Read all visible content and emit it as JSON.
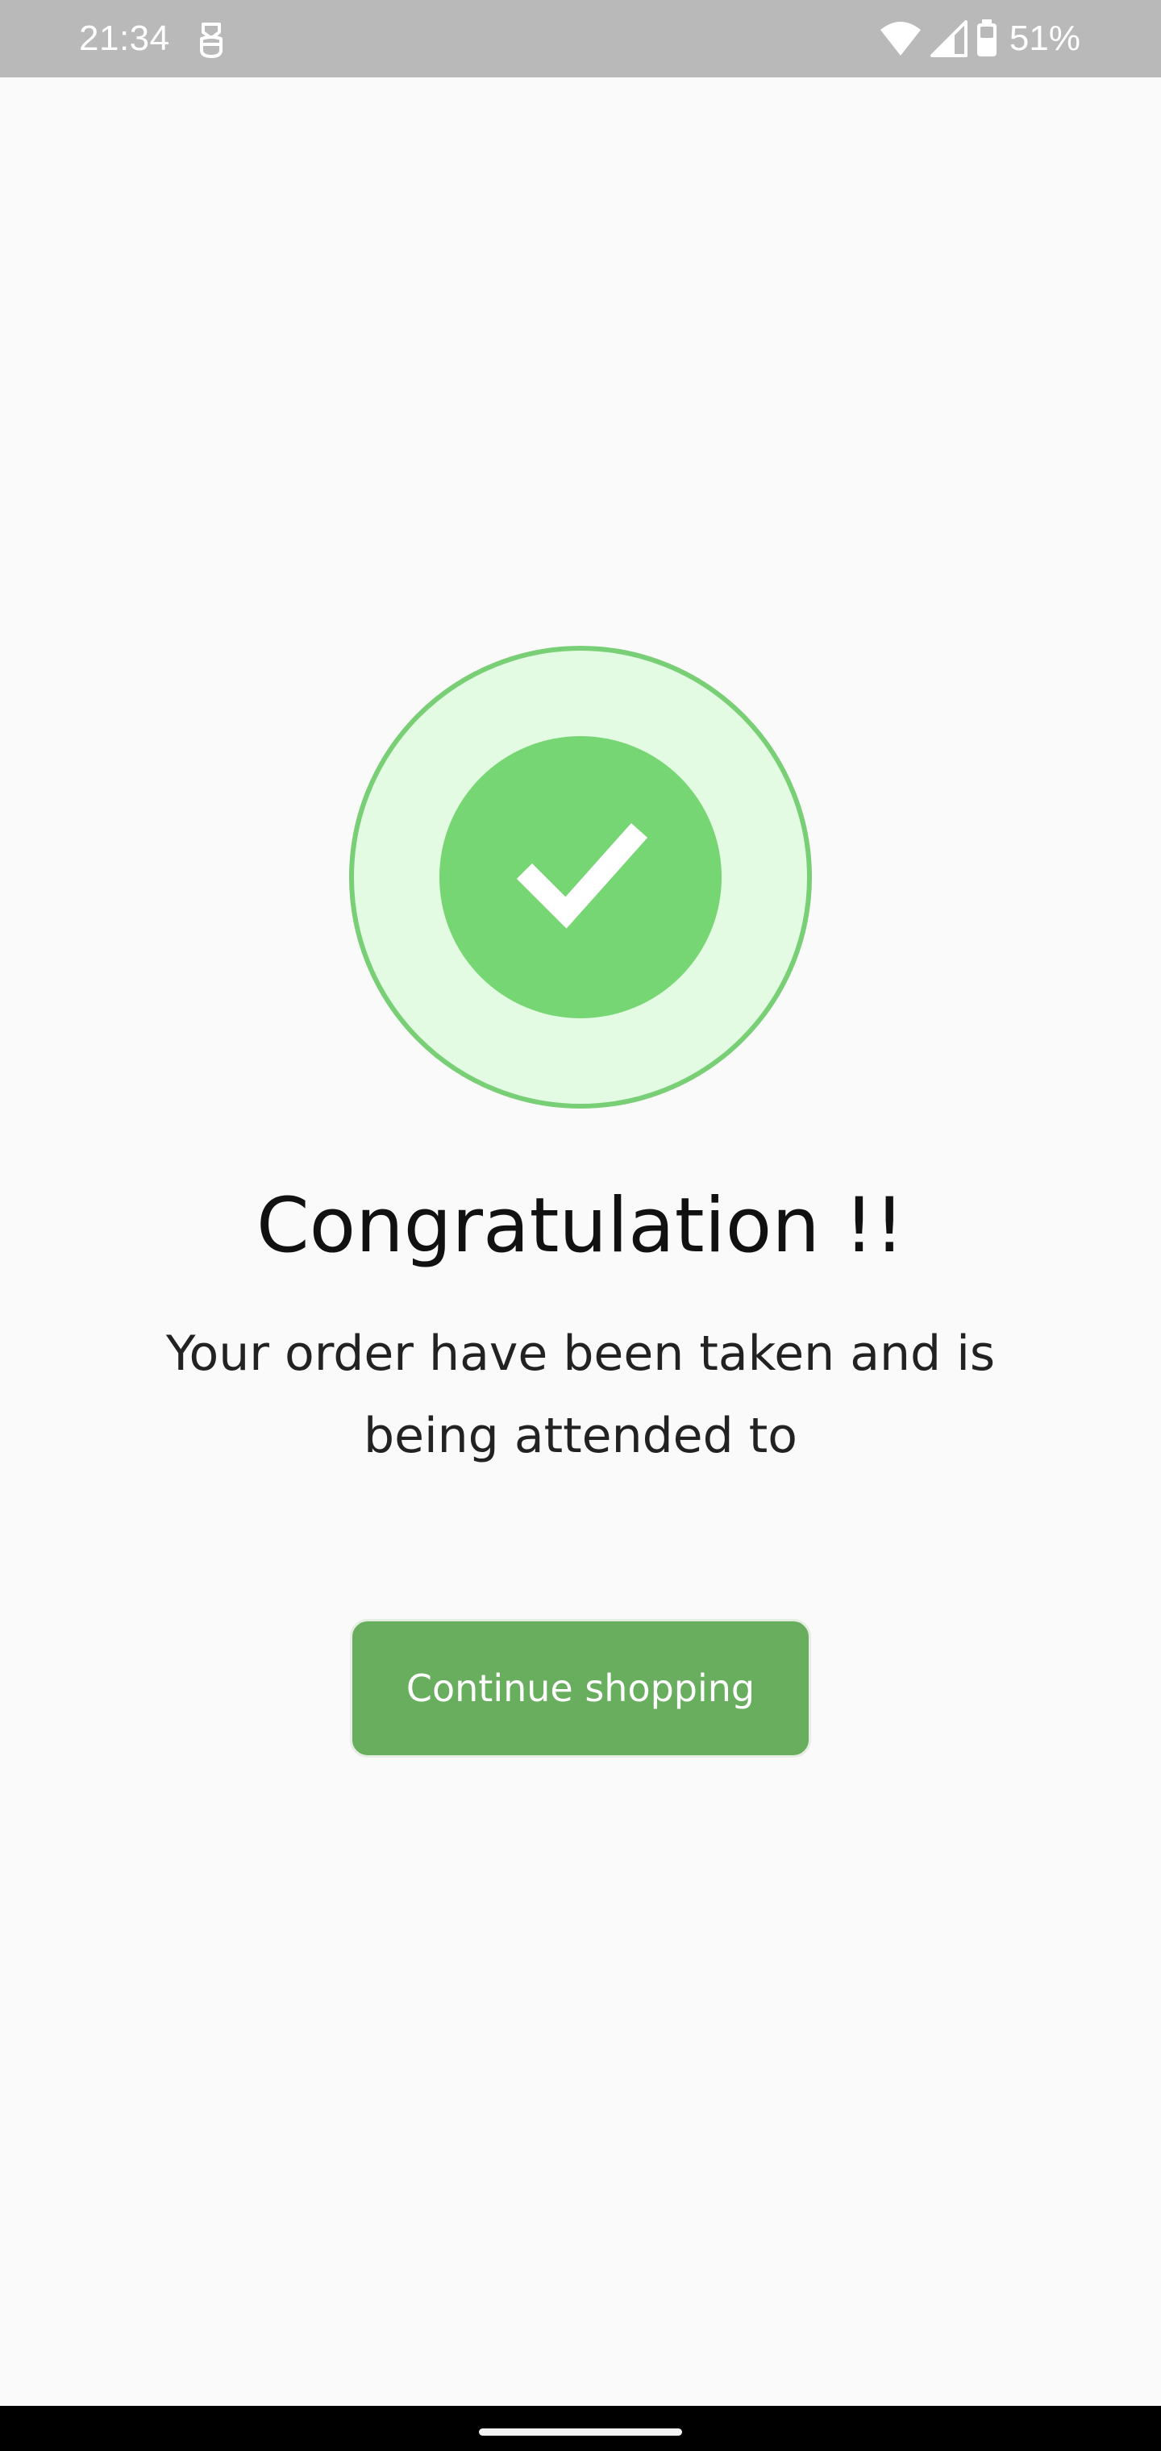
{
  "status_bar": {
    "time": "21:34",
    "battery_percent": "51%",
    "notification_icon": "keyboard-app-icon",
    "icons": [
      "wifi-icon",
      "cellular-signal-icon",
      "battery-icon"
    ],
    "background_color": "#b9b9b9"
  },
  "success": {
    "icon": "check-icon",
    "outer_color": "#e3fae3",
    "ring_color": "#79cf75",
    "inner_color": "#77d674"
  },
  "content": {
    "title": "Congratulation !!",
    "message": "Your order have been taken and is being attended to"
  },
  "actions": {
    "continue_label": "Continue shopping",
    "button_color": "#68ae5e"
  }
}
